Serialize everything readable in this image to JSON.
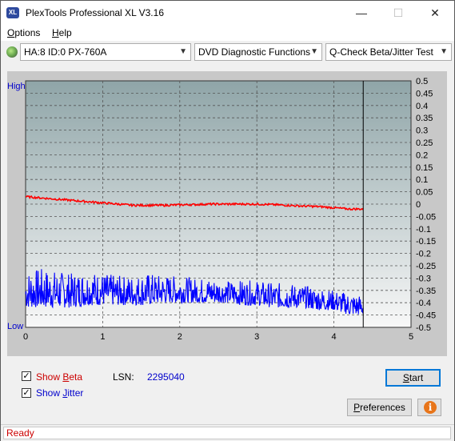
{
  "window": {
    "title": "PlexTools Professional XL V3.16",
    "icon_text": "XL"
  },
  "menu": {
    "items": [
      {
        "label": "Options"
      },
      {
        "label": "Help"
      }
    ]
  },
  "toolbar": {
    "drive": "HA:8 ID:0  PX-760A",
    "function": "DVD Diagnostic Functions",
    "test": "Q-Check Beta/Jitter Test"
  },
  "chart_data": {
    "type": "line",
    "y_left_labels": {
      "high": "High",
      "low": "Low"
    },
    "x_ticks": [
      0,
      1,
      2,
      3,
      4,
      5
    ],
    "y_ticks": [
      0.5,
      0.45,
      0.4,
      0.35,
      0.3,
      0.25,
      0.2,
      0.15,
      0.1,
      0.05,
      0,
      -0.05,
      -0.1,
      -0.15,
      -0.2,
      -0.25,
      -0.3,
      -0.35,
      -0.4,
      -0.45,
      -0.5
    ],
    "xlim": [
      0,
      5
    ],
    "ylim": [
      -0.5,
      0.5
    ],
    "cursor_x": 4.38,
    "series": [
      {
        "name": "Beta",
        "color": "#ff0000",
        "x": [
          0,
          0.2,
          0.4,
          0.6,
          0.8,
          1.0,
          1.2,
          1.4,
          1.6,
          1.8,
          2.0,
          2.2,
          2.4,
          2.6,
          2.8,
          3.0,
          3.2,
          3.4,
          3.6,
          3.8,
          4.0,
          4.2,
          4.38
        ],
        "y": [
          0.03,
          0.025,
          0.02,
          0.015,
          0.01,
          0.005,
          0.0,
          -0.005,
          -0.005,
          -0.005,
          -0.003,
          -0.002,
          0.0,
          0.0,
          0.0,
          0.0,
          -0.002,
          -0.005,
          -0.008,
          -0.01,
          -0.015,
          -0.02,
          -0.02
        ]
      },
      {
        "name": "Jitter",
        "color": "#0000ff",
        "x": [
          0,
          0.2,
          0.4,
          0.6,
          0.8,
          1.0,
          1.2,
          1.4,
          1.6,
          1.8,
          2.0,
          2.2,
          2.4,
          2.6,
          2.8,
          3.0,
          3.2,
          3.4,
          3.6,
          3.8,
          4.0,
          4.2,
          4.38
        ],
        "y_top": [
          -0.27,
          -0.26,
          -0.27,
          -0.28,
          -0.27,
          -0.28,
          -0.29,
          -0.29,
          -0.28,
          -0.29,
          -0.29,
          -0.3,
          -0.3,
          -0.31,
          -0.31,
          -0.31,
          -0.32,
          -0.32,
          -0.33,
          -0.34,
          -0.35,
          -0.36,
          -0.37
        ],
        "y_bottom": [
          -0.42,
          -0.42,
          -0.42,
          -0.42,
          -0.41,
          -0.41,
          -0.41,
          -0.41,
          -0.41,
          -0.4,
          -0.4,
          -0.4,
          -0.4,
          -0.4,
          -0.41,
          -0.41,
          -0.42,
          -0.42,
          -0.42,
          -0.43,
          -0.43,
          -0.45,
          -0.45
        ]
      }
    ]
  },
  "controls": {
    "show_beta_label": "Show Beta",
    "show_beta_checked": true,
    "show_jitter_label": "Show Jitter",
    "show_jitter_checked": true,
    "lsn_label": "LSN:",
    "lsn_value": "2295040",
    "start_label": "Start",
    "preferences_label": "Preferences",
    "info_icon": "info-icon",
    "beta_color": "#cc0000",
    "jitter_color": "#0000cc"
  },
  "status": {
    "text": "Ready"
  }
}
